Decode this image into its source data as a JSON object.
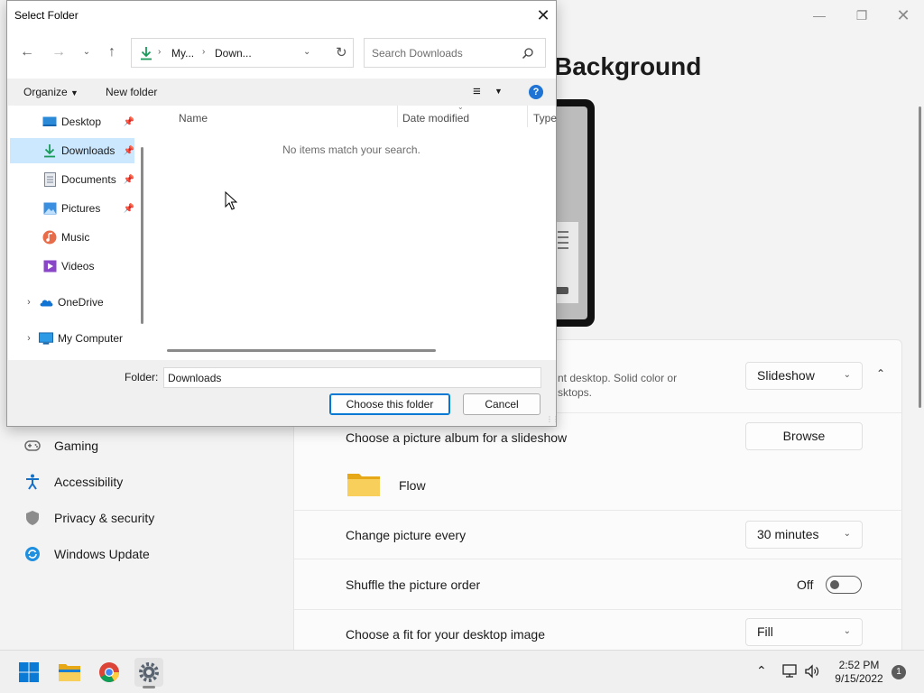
{
  "settings": {
    "page_title": "Background",
    "nav": [
      {
        "label": "Gaming",
        "icon": "gamepad-icon"
      },
      {
        "label": "Accessibility",
        "icon": "accessibility-icon"
      },
      {
        "label": "Privacy & security",
        "icon": "shield-icon"
      },
      {
        "label": "Windows Update",
        "icon": "windows-update-icon"
      }
    ],
    "personalize": {
      "desc_line1": "nt desktop. Solid color or",
      "desc_line2": "sktops.",
      "value": "Slideshow"
    },
    "album": {
      "label": "Choose a picture album for a slideshow",
      "button": "Browse",
      "folder_name": "Flow"
    },
    "interval": {
      "label": "Change picture every",
      "value": "30 minutes"
    },
    "shuffle": {
      "label": "Shuffle the picture order",
      "state": "Off"
    },
    "fit": {
      "label": "Choose a fit for your desktop image",
      "value": "Fill"
    }
  },
  "dialog": {
    "title": "Select Folder",
    "address": {
      "segment1": "My...",
      "segment2": "Down..."
    },
    "search_placeholder": "Search Downloads",
    "toolbar": {
      "organize": "Organize",
      "new_folder": "New folder"
    },
    "nav_items": [
      {
        "label": "Desktop",
        "pinned": true
      },
      {
        "label": "Downloads",
        "pinned": true,
        "selected": true
      },
      {
        "label": "Documents",
        "pinned": true
      },
      {
        "label": "Pictures",
        "pinned": true
      },
      {
        "label": "Music",
        "pinned": false
      },
      {
        "label": "Videos",
        "pinned": false
      },
      {
        "label": "OneDrive",
        "pinned": false
      },
      {
        "label": "My Computer",
        "pinned": false
      }
    ],
    "columns": [
      "Name",
      "Date modified",
      "Type"
    ],
    "empty_message": "No items match your search.",
    "folder_label": "Folder:",
    "folder_value": "Downloads",
    "choose_button": "Choose this folder",
    "cancel_button": "Cancel"
  },
  "taskbar": {
    "time": "2:52 PM",
    "date": "9/15/2022",
    "notification_count": "1"
  },
  "colors": {
    "accent": "#0078d4",
    "selection": "#cce8ff",
    "folder": "#f4c542"
  }
}
